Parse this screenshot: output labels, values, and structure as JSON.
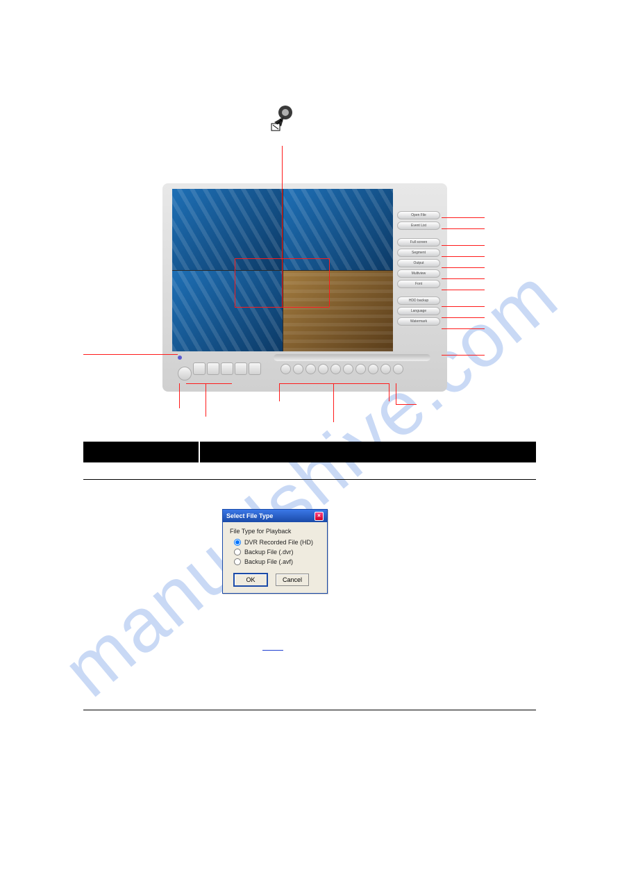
{
  "watermark": "manualshive.com",
  "player_sidebar": {
    "group1": [
      "Open File",
      "Event List"
    ],
    "group2": [
      "Full screen",
      "Segment",
      "Output",
      "Multiview",
      "Font"
    ],
    "group3": [
      "HDD backup",
      "Language",
      "Watermark"
    ]
  },
  "dialog": {
    "title": "Select File Type",
    "group_label": "File Type for Playback",
    "options": {
      "opt1": "DVR Recorded File (HD)",
      "opt2": "Backup File (.dvr)",
      "opt3": "Backup File (.avf)"
    },
    "ok": "OK",
    "cancel": "Cancel"
  }
}
